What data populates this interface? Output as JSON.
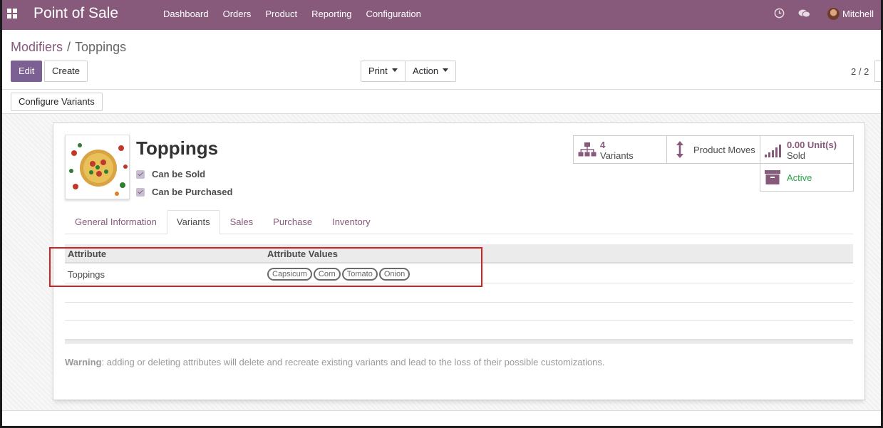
{
  "app": {
    "title": "Point of Sale",
    "menu": [
      "Dashboard",
      "Orders",
      "Product",
      "Reporting",
      "Configuration"
    ],
    "user_name": "Mitchell"
  },
  "breadcrumb": {
    "parent": "Modifiers",
    "separator": "/",
    "current": "Toppings"
  },
  "toolbar": {
    "edit_label": "Edit",
    "create_label": "Create",
    "print_label": "Print",
    "action_label": "Action",
    "pager": "2 / 2"
  },
  "statusbar": {
    "configure_variants_label": "Configure Variants"
  },
  "product": {
    "name": "Toppings",
    "can_be_sold_label": "Can be Sold",
    "can_be_purchased_label": "Can be Purchased",
    "can_be_sold": true,
    "can_be_purchased": true
  },
  "smart_buttons": {
    "variants": {
      "value": "4",
      "label": "Variants",
      "icon": "sitemap-icon"
    },
    "product_moves": {
      "label": "Product Moves",
      "icon": "arrows-vertical-icon"
    },
    "sold": {
      "value": "0.00 Unit(s)",
      "label": "Sold",
      "icon": "signal-bars-icon"
    },
    "active": {
      "label": "Active",
      "icon": "archive-icon"
    }
  },
  "tabs": [
    "General Information",
    "Variants",
    "Sales",
    "Purchase",
    "Inventory"
  ],
  "active_tab": "Variants",
  "variants_table": {
    "columns": [
      "Attribute",
      "Attribute Values"
    ],
    "rows": [
      {
        "attribute": "Toppings",
        "values": [
          "Capsicum",
          "Corn",
          "Tomato",
          "Onion"
        ]
      }
    ]
  },
  "warning": {
    "bold": "Warning",
    "text": ": adding or deleting attributes will delete and recreate existing variants and lead to the loss of their possible customizations."
  },
  "colors": {
    "brand": "#875a7b",
    "primary_button": "#7c5f93",
    "active_green": "#28a745",
    "highlight_red": "#d61f1f"
  }
}
